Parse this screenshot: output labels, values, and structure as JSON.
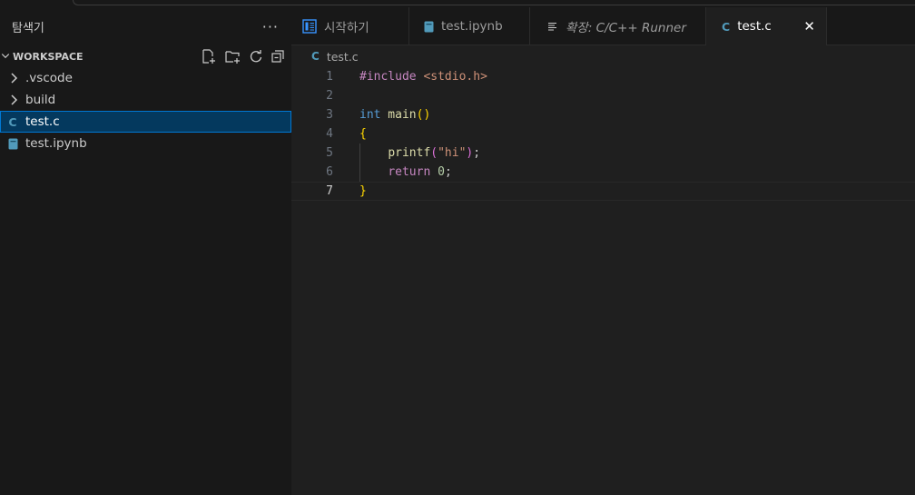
{
  "sidebar": {
    "title": "탐색기",
    "more_label": "···",
    "workspace_label": "WORKSPACE",
    "items": [
      {
        "label": ".vscode",
        "type": "folder"
      },
      {
        "label": "build",
        "type": "folder"
      },
      {
        "label": "test.c",
        "type": "c-file",
        "selected": true
      },
      {
        "label": "test.ipynb",
        "type": "notebook"
      }
    ]
  },
  "tabs": [
    {
      "label": "시작하기",
      "icon": "welcome-icon"
    },
    {
      "label": "test.ipynb",
      "icon": "notebook-icon"
    },
    {
      "label": "확장: C/C++ Runner",
      "icon": "extension-preview-icon",
      "italic": true
    },
    {
      "label": "test.c",
      "icon": "c-file-icon",
      "active": true,
      "close": "✕"
    }
  ],
  "breadcrumb": {
    "file": "test.c",
    "icon_letter": "C"
  },
  "file_icon_letter": "C",
  "code": {
    "line_numbers": [
      "1",
      "2",
      "3",
      "4",
      "5",
      "6",
      "7"
    ],
    "current_line": 7,
    "tokens": {
      "l1_directive": "#include",
      "l1_header": " <stdio.h>",
      "l3_type": "int",
      "l3_func": " main",
      "l3_parens": "()",
      "l4_brace": "{",
      "l5_func": "printf",
      "l5_open": "(",
      "l5_str": "\"hi\"",
      "l5_close": ")",
      "l5_semi": ";",
      "l6_kw": "return",
      "l6_num": "0",
      "l6_semi": ";",
      "l7_brace": "}"
    }
  },
  "colors": {
    "accent": "#0078d4",
    "selection": "#04395e",
    "c_icon": "#519aba"
  }
}
